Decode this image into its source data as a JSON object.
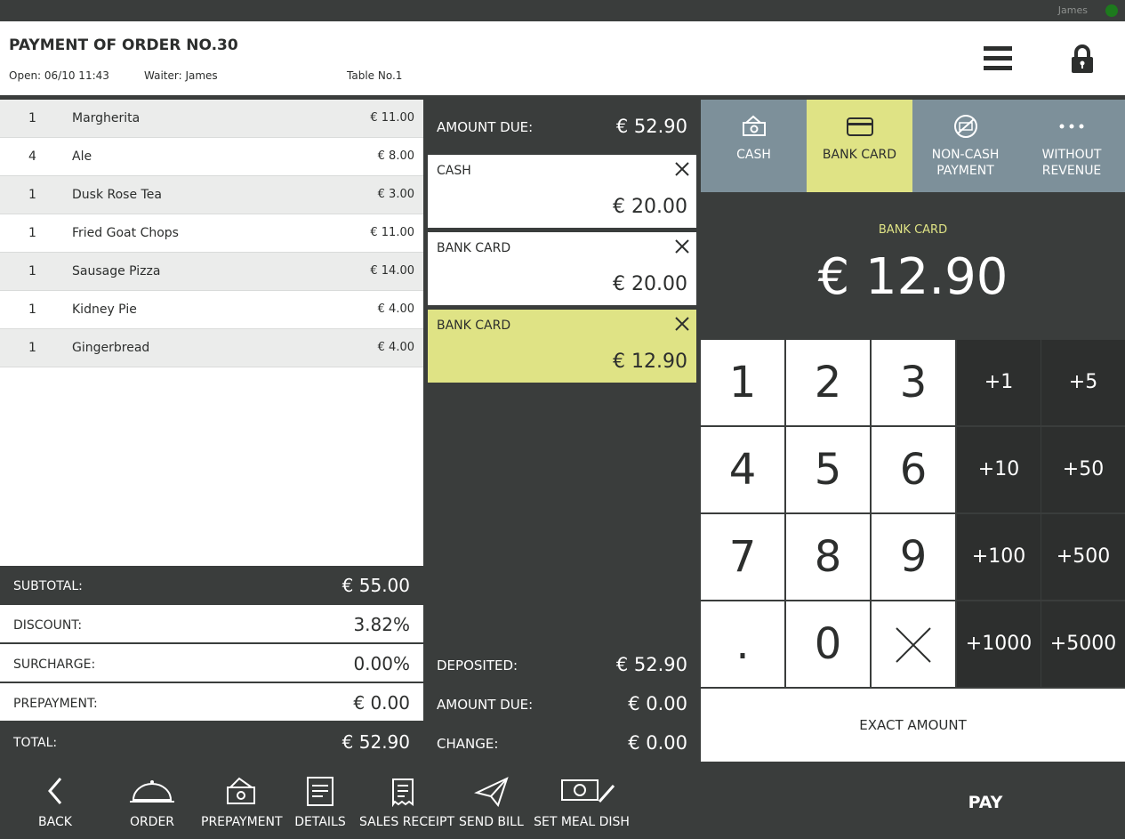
{
  "topbar": {
    "user": "James"
  },
  "header": {
    "title": "PAYMENT OF ORDER NO.30",
    "open": "Open: 06/10 11:43",
    "waiter": "Waiter: James",
    "table": "Table No.1"
  },
  "order_items": [
    {
      "qty": "1",
      "name": "Margherita",
      "price": "€ 11.00"
    },
    {
      "qty": "4",
      "name": "Ale",
      "price": "€ 8.00"
    },
    {
      "qty": "1",
      "name": "Dusk Rose Tea",
      "price": "€ 3.00"
    },
    {
      "qty": "1",
      "name": "Fried Goat Chops",
      "price": "€ 11.00"
    },
    {
      "qty": "1",
      "name": "Sausage Pizza",
      "price": "€ 14.00"
    },
    {
      "qty": "1",
      "name": "Kidney Pie",
      "price": "€ 4.00"
    },
    {
      "qty": "1",
      "name": "Gingerbread",
      "price": "€ 4.00"
    }
  ],
  "totals": {
    "subtotal_label": "SUBTOTAL:",
    "subtotal": "€ 55.00",
    "discount_label": "DISCOUNT:",
    "discount": "3.82%",
    "surcharge_label": "SURCHARGE:",
    "surcharge": "0.00%",
    "prepayment_label": "PREPAYMENT:",
    "prepayment": "€ 0.00",
    "total_label": "TOTAL:",
    "total": "€ 52.90"
  },
  "payments": {
    "amount_due_label": "AMOUNT DUE:",
    "amount_due": "€ 52.90",
    "entries": [
      {
        "label": "CASH",
        "amount": "€ 20.00",
        "selected": false
      },
      {
        "label": "BANK CARD",
        "amount": "€ 20.00",
        "selected": false
      },
      {
        "label": "BANK CARD",
        "amount": "€ 12.90",
        "selected": true
      }
    ],
    "deposited_label": "DEPOSITED:",
    "deposited": "€ 52.90",
    "remaining_label": "AMOUNT DUE:",
    "remaining": "€ 0.00",
    "change_label": "CHANGE:",
    "change": "€ 0.00"
  },
  "methods": [
    {
      "line1": "CASH",
      "line2": "",
      "icon": "cash-icon",
      "selected": false
    },
    {
      "line1": "BANK CARD",
      "line2": "",
      "icon": "card-icon",
      "selected": true
    },
    {
      "line1": "NON-CASH",
      "line2": "PAYMENT",
      "icon": "no-cash-icon",
      "selected": false
    },
    {
      "line1": "WITHOUT",
      "line2": "REVENUE",
      "icon": "more-icon",
      "selected": false
    }
  ],
  "display": {
    "label": "BANK CARD",
    "amount": "€ 12.90"
  },
  "keypad": {
    "digits": [
      "1",
      "2",
      "3",
      "4",
      "5",
      "6",
      "7",
      "8",
      "9",
      ".",
      "0"
    ],
    "quick": [
      "+1",
      "+5",
      "+10",
      "+50",
      "+100",
      "+500",
      "+1000",
      "+5000"
    ],
    "exact": "EXACT AMOUNT"
  },
  "bottom": {
    "back": "BACK",
    "order": "ORDER",
    "prepayment": "PREPAYMENT",
    "details": "DETAILS",
    "sales_receipt": "SALES RECEIPT",
    "send_bill": "SEND BILL",
    "set_meal": "SET MEAL DISH",
    "pay": "PAY"
  },
  "colors": {
    "accent": "#dfe385",
    "dark": "#3a3d3c",
    "method_bg": "#7d909a",
    "status_online": "#1d7a1d"
  }
}
